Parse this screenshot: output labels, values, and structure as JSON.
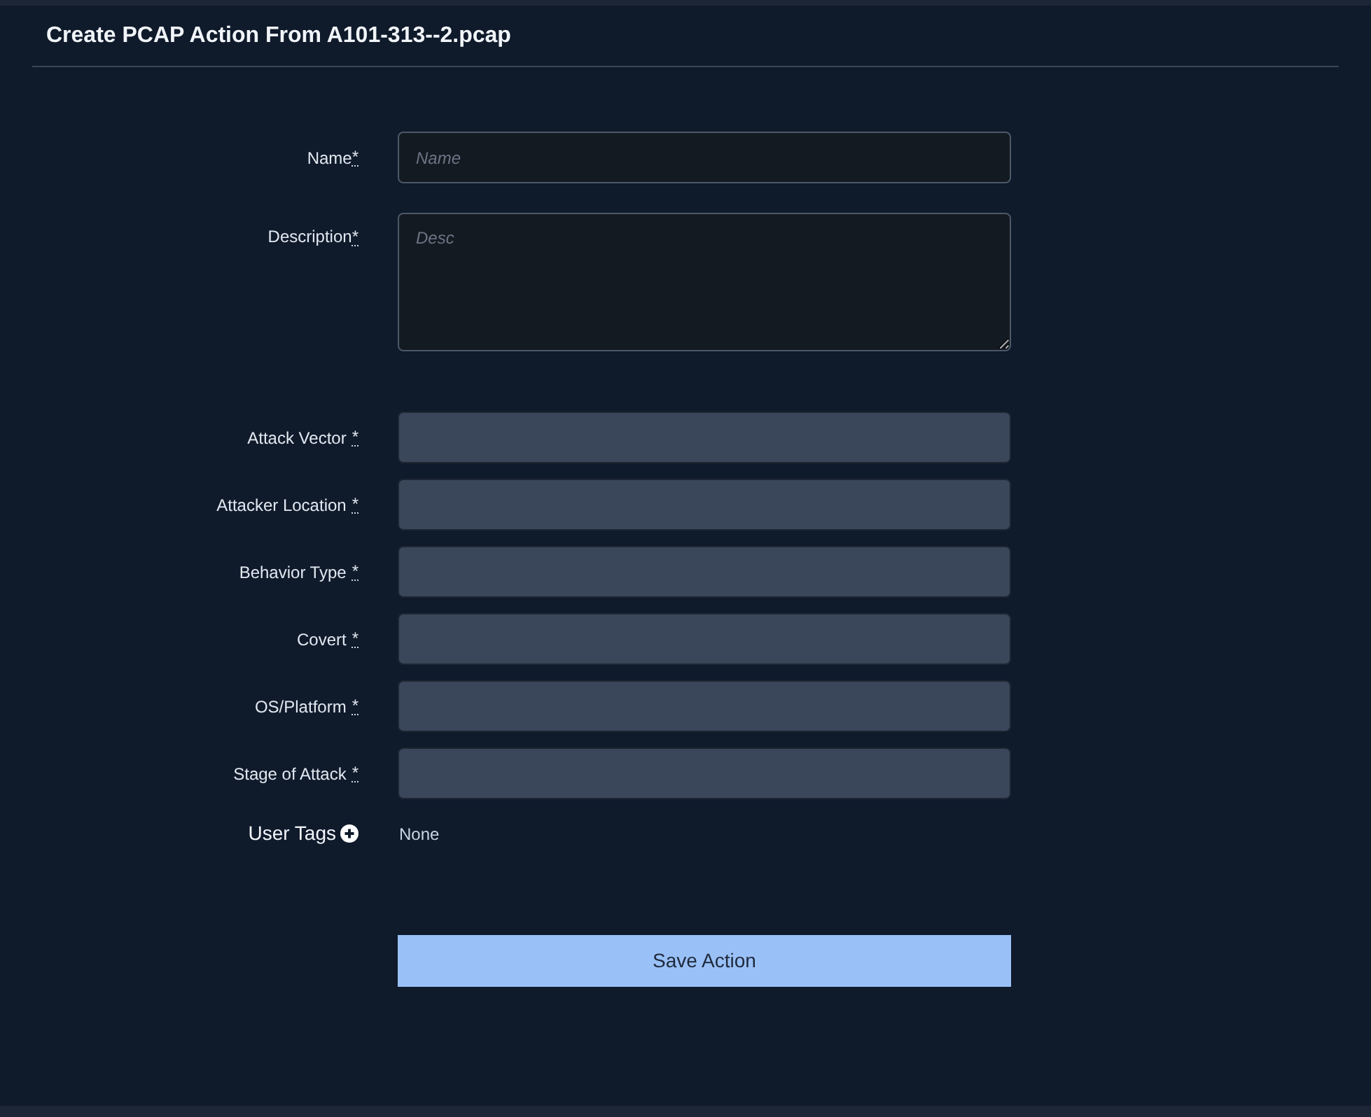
{
  "title": "Create PCAP Action From A101-313--2.pcap",
  "fields": [
    {
      "kind": "text",
      "label": "Name",
      "required_mark": "*",
      "placeholder": "Name"
    },
    {
      "kind": "textarea",
      "label": "Description",
      "required_mark": "*",
      "placeholder": "Desc"
    },
    {
      "kind": "select",
      "label": "Attack Vector",
      "required_mark": "*"
    },
    {
      "kind": "select",
      "label": "Attacker Location",
      "required_mark": "*"
    },
    {
      "kind": "select",
      "label": "Behavior Type",
      "required_mark": "*"
    },
    {
      "kind": "select",
      "label": "Covert",
      "required_mark": "*"
    },
    {
      "kind": "select",
      "label": "OS/Platform",
      "required_mark": "*"
    },
    {
      "kind": "select",
      "label": "Stage of Attack",
      "required_mark": "*"
    }
  ],
  "user_tags": {
    "label": "User Tags",
    "value": "None"
  },
  "button": "Save Action"
}
